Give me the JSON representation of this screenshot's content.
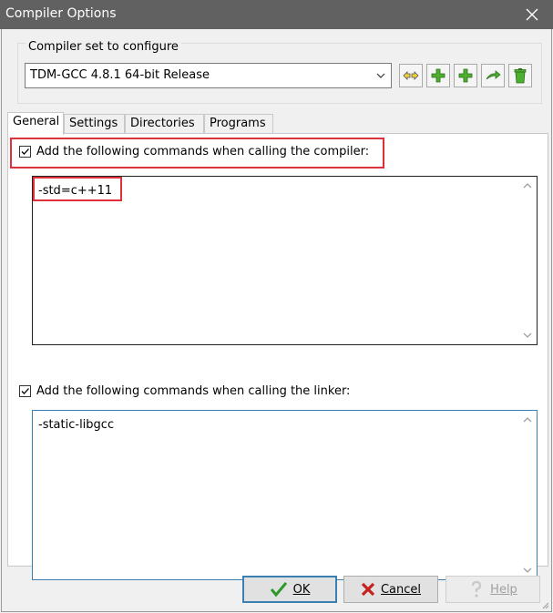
{
  "window": {
    "title": "Compiler Options",
    "close_glyph": "✕"
  },
  "compiler_set": {
    "label": "Compiler set to configure",
    "selected": "TDM-GCC 4.8.1 64-bit Release",
    "toolbar_icons": [
      "rename-icon",
      "add-icon",
      "add-folder-icon",
      "rename-arrow-icon",
      "trash-icon"
    ]
  },
  "tabs": [
    {
      "label": "General",
      "active": true
    },
    {
      "label": "Settings"
    },
    {
      "label": "Directories"
    },
    {
      "label": "Programs"
    }
  ],
  "compiler_cmds": {
    "checkbox_label": "Add the following commands when calling the compiler:",
    "checked": true,
    "value": "-std=c++11"
  },
  "linker_cmds": {
    "checkbox_label": "Add the following commands when calling the linker:",
    "checked": true,
    "value": "-static-libgcc"
  },
  "buttons": {
    "ok": "OK",
    "cancel": "Cancel",
    "help": "Help"
  },
  "colors": {
    "highlight": "#e0303a",
    "focus": "#3c7fb1",
    "titlebar": "#616161"
  }
}
